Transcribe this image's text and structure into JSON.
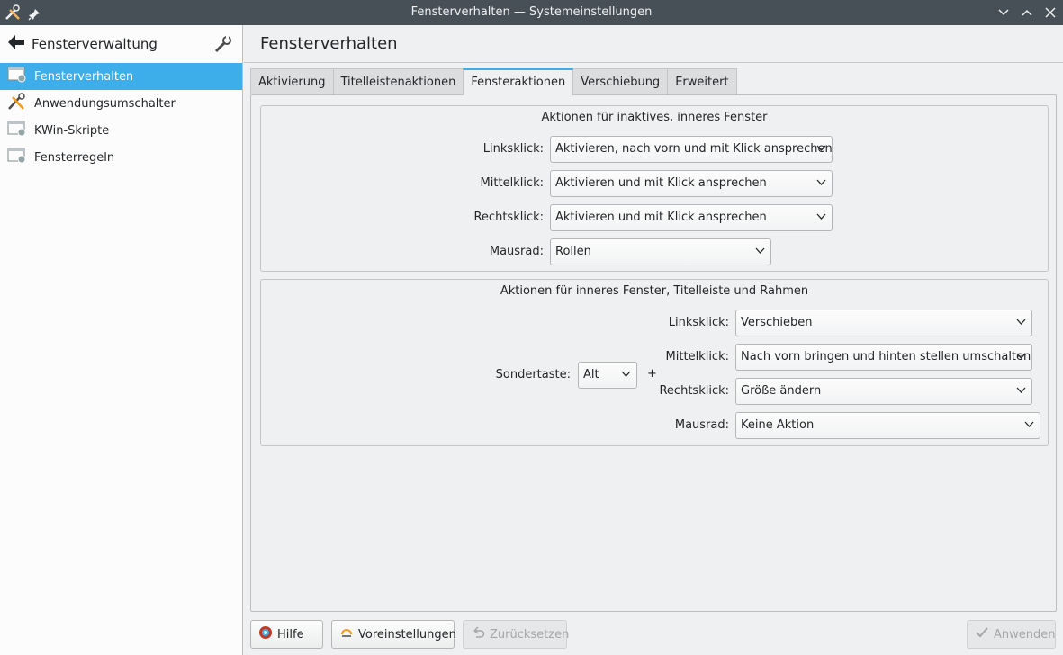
{
  "window": {
    "title": "Fensterverhalten — Systemeinstellungen"
  },
  "sidebar": {
    "title": "Fensterverwaltung",
    "items": [
      {
        "label": "Fensterverhalten",
        "icon": "window-settings-icon"
      },
      {
        "label": "Anwendungsumschalter",
        "icon": "tools-icon"
      },
      {
        "label": "KWin-Skripte",
        "icon": "window-settings-icon"
      },
      {
        "label": "Fensterregeln",
        "icon": "window-settings-icon"
      }
    ]
  },
  "main": {
    "title": "Fensterverhalten",
    "tabs": [
      "Aktivierung",
      "Titelleistenaktionen",
      "Fensteraktionen",
      "Verschiebung",
      "Erweitert"
    ],
    "active_tab": "Fensteraktionen",
    "inactive_group": {
      "title": "Aktionen für inaktives, inneres Fenster",
      "rows": [
        {
          "label": "Linksklick:",
          "value": "Aktivieren, nach vorn und mit Klick ansprechen"
        },
        {
          "label": "Mittelklick:",
          "value": "Aktivieren und mit Klick ansprechen"
        },
        {
          "label": "Rechtsklick:",
          "value": "Aktivieren und mit Klick ansprechen"
        },
        {
          "label": "Mausrad:",
          "value": "Rollen"
        }
      ]
    },
    "inner_group": {
      "title": "Aktionen für inneres Fenster, Titelleiste und Rahmen",
      "modifier_label": "Sondertaste:",
      "modifier_value": "Alt",
      "plus": "+",
      "rows": [
        {
          "label": "Linksklick:",
          "value": "Verschieben"
        },
        {
          "label": "Mittelklick:",
          "value": "Nach vorn bringen und hinten stellen umschalten"
        },
        {
          "label": "Rechtsklick:",
          "value": "Größe ändern"
        },
        {
          "label": "Mausrad:",
          "value": "Keine Aktion"
        }
      ]
    }
  },
  "buttons": {
    "help": "Hilfe",
    "defaults": "Voreinstellungen",
    "reset": "Zurücksetzen",
    "apply": "Anwenden"
  },
  "colors": {
    "accent": "#3daee9",
    "titlebar": "#475057"
  }
}
